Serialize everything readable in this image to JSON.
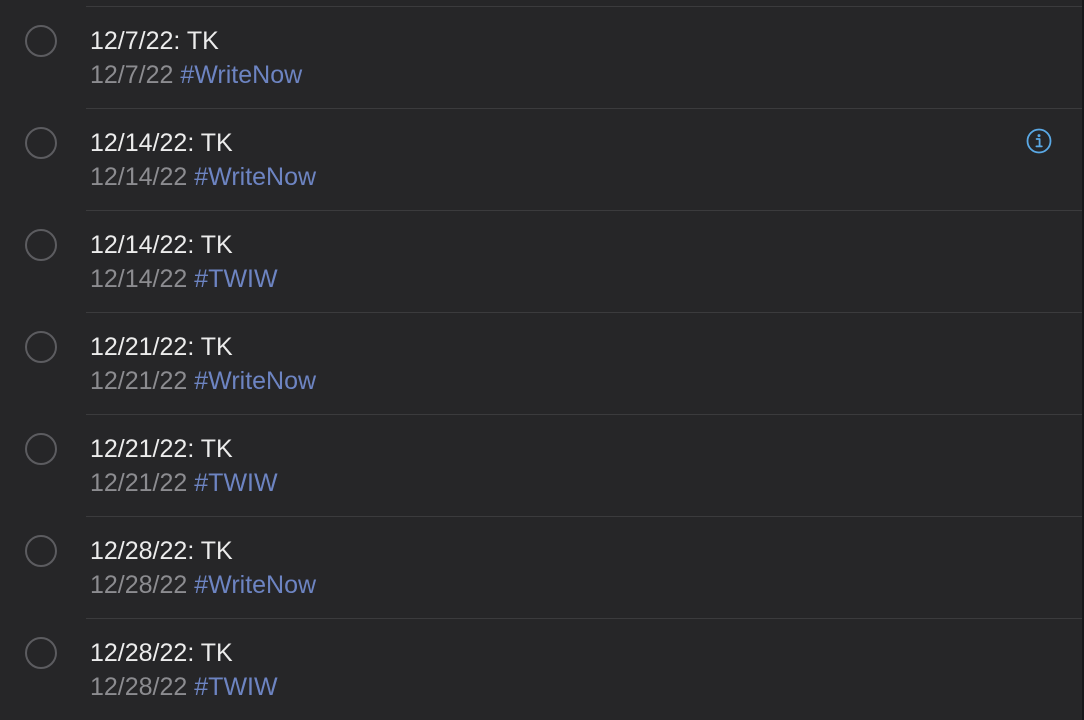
{
  "colors": {
    "background": "#262628",
    "separator": "#3b3b3d",
    "title_text": "#ececec",
    "date_text": "#8c8c90",
    "tag_text": "#6d84c2",
    "info_icon": "#5aa9e6"
  },
  "reminders": [
    {
      "title": "12/7/22: TK",
      "date": "12/7/22",
      "tag": "#WriteNow",
      "show_info": false
    },
    {
      "title": "12/14/22: TK",
      "date": "12/14/22",
      "tag": "#WriteNow",
      "show_info": true
    },
    {
      "title": "12/14/22: TK",
      "date": "12/14/22",
      "tag": "#TWIW",
      "show_info": false
    },
    {
      "title": "12/21/22: TK",
      "date": "12/21/22",
      "tag": "#WriteNow",
      "show_info": false
    },
    {
      "title": "12/21/22: TK",
      "date": "12/21/22",
      "tag": "#TWIW",
      "show_info": false
    },
    {
      "title": "12/28/22: TK",
      "date": "12/28/22",
      "tag": "#WriteNow",
      "show_info": false
    },
    {
      "title": "12/28/22: TK",
      "date": "12/28/22",
      "tag": "#TWIW",
      "show_info": false
    }
  ],
  "icons": {
    "checkbox": "circle-checkbox-icon",
    "info": "info-icon"
  }
}
